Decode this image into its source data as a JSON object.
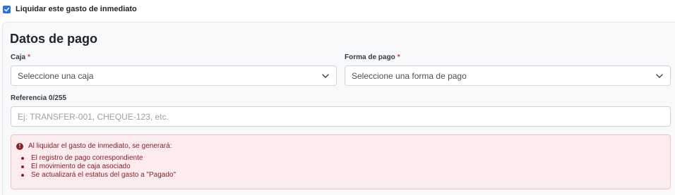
{
  "settle_now": {
    "label": "Liquidar este gasto de inmediato",
    "checked": true
  },
  "payment": {
    "title": "Datos de pago",
    "cash_box": {
      "label": "Caja",
      "required_mark": "*",
      "placeholder": "Seleccione una caja"
    },
    "payment_method": {
      "label": "Forma de pago",
      "required_mark": "*",
      "placeholder": "Seleccione una forma de pago"
    },
    "reference": {
      "label": "Referencia 0/255",
      "placeholder": "Ej: TRANSFER-001, CHEQUE-123, etc."
    }
  },
  "alert": {
    "icon": "info-icon",
    "heading": "Al liquidar el gasto de inmediato, se generará:",
    "items": [
      "El registro de pago correspondiente",
      "El movimiento de caja asociado",
      "Se actualizará el estatus del gasto a \"Pagado\""
    ]
  },
  "colors": {
    "accent": "#2f6fde",
    "required": "#dc3545",
    "alert_bg": "#fdecee",
    "alert_text": "#842029"
  }
}
